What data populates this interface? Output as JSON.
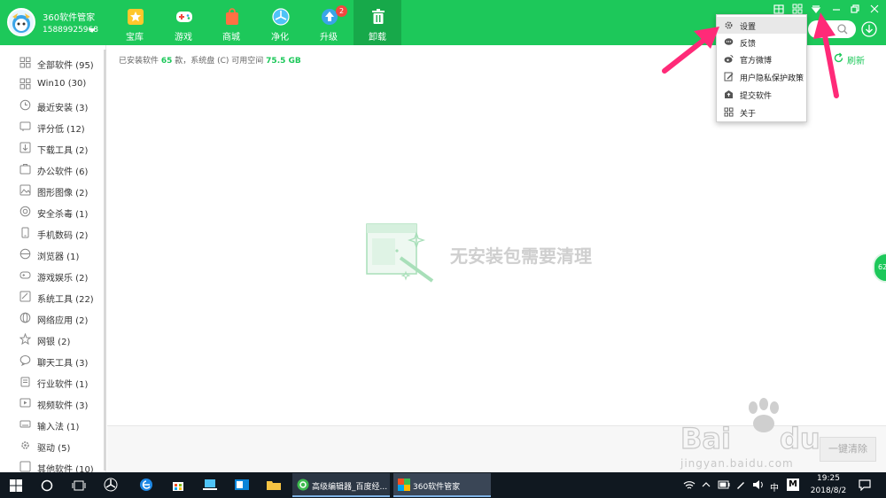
{
  "header": {
    "app_title": "360软件管家",
    "account": "15889925968",
    "tabs": [
      {
        "label": "宝库",
        "icon": "star-icon"
      },
      {
        "label": "游戏",
        "icon": "gamepad-icon"
      },
      {
        "label": "商城",
        "icon": "shopping-bag-icon"
      },
      {
        "label": "净化",
        "icon": "fan-icon"
      },
      {
        "label": "升级",
        "icon": "upgrade-arrow-icon",
        "badge": "2"
      },
      {
        "label": "卸载",
        "icon": "trash-icon"
      }
    ]
  },
  "sidebar": {
    "items": [
      {
        "label": "全部软件 (95)",
        "icon": "grid-icon"
      },
      {
        "label": "Win10 (30)",
        "icon": "windows-icon"
      },
      {
        "label": "最近安装 (3)",
        "icon": "clock-icon"
      },
      {
        "label": "评分低 (12)",
        "icon": "thumbs-down-icon"
      },
      {
        "label": "下载工具 (2)",
        "icon": "download-icon"
      },
      {
        "label": "办公软件 (6)",
        "icon": "briefcase-icon"
      },
      {
        "label": "图形图像 (2)",
        "icon": "image-icon"
      },
      {
        "label": "安全杀毒 (1)",
        "icon": "shield-icon"
      },
      {
        "label": "手机数码 (2)",
        "icon": "phone-icon"
      },
      {
        "label": "浏览器 (1)",
        "icon": "browser-icon"
      },
      {
        "label": "游戏娱乐 (2)",
        "icon": "gamepad-icon"
      },
      {
        "label": "系统工具 (22)",
        "icon": "tools-icon"
      },
      {
        "label": "网络应用 (2)",
        "icon": "globe-icon"
      },
      {
        "label": "网银 (2)",
        "icon": "star-icon"
      },
      {
        "label": "聊天工具 (3)",
        "icon": "chat-icon"
      },
      {
        "label": "行业软件 (1)",
        "icon": "clipboard-icon"
      },
      {
        "label": "视频软件 (3)",
        "icon": "video-icon"
      },
      {
        "label": "输入法 (1)",
        "icon": "keyboard-icon"
      },
      {
        "label": "驱动 (5)",
        "icon": "gear-icon"
      },
      {
        "label": "其他软件 (10)",
        "icon": "more-icon"
      }
    ]
  },
  "main": {
    "summary_prefix": "已安装软件 ",
    "installed_count": "65",
    "summary_middle": " 款，系统盘 (C) 可用空间 ",
    "free_space": "75.5 GB",
    "refresh_label": "刷新",
    "empty_message": "无安装包需要清理",
    "clean_button": "一键清除",
    "float_ball_value": "62"
  },
  "menu": {
    "items": [
      {
        "label": "设置",
        "icon": "gear-icon"
      },
      {
        "label": "反馈",
        "icon": "chat-icon"
      },
      {
        "label": "官方微博",
        "icon": "weibo-icon"
      },
      {
        "label": "用户隐私保护政策",
        "icon": "document-edit-icon"
      },
      {
        "label": "提交软件",
        "icon": "upload-icon"
      },
      {
        "label": "关于",
        "icon": "grid-icon"
      }
    ]
  },
  "taskbar": {
    "apps": [
      {
        "label": "高级编辑器_百度经...",
        "icon": "browser-360-icon"
      },
      {
        "label": "360软件管家",
        "icon": "360-manager-icon"
      }
    ],
    "ime": "中",
    "ime_mode": "M",
    "time": "19:25",
    "date": "2018/8/2"
  },
  "watermark": {
    "text": "jingyan.baidu.com"
  },
  "colors": {
    "brand_green": "#1dc85a",
    "active_tab": "#17a94a",
    "badge_red": "#f2473f",
    "arrow_pink": "#ff2a78",
    "taskbar": "#101820"
  }
}
